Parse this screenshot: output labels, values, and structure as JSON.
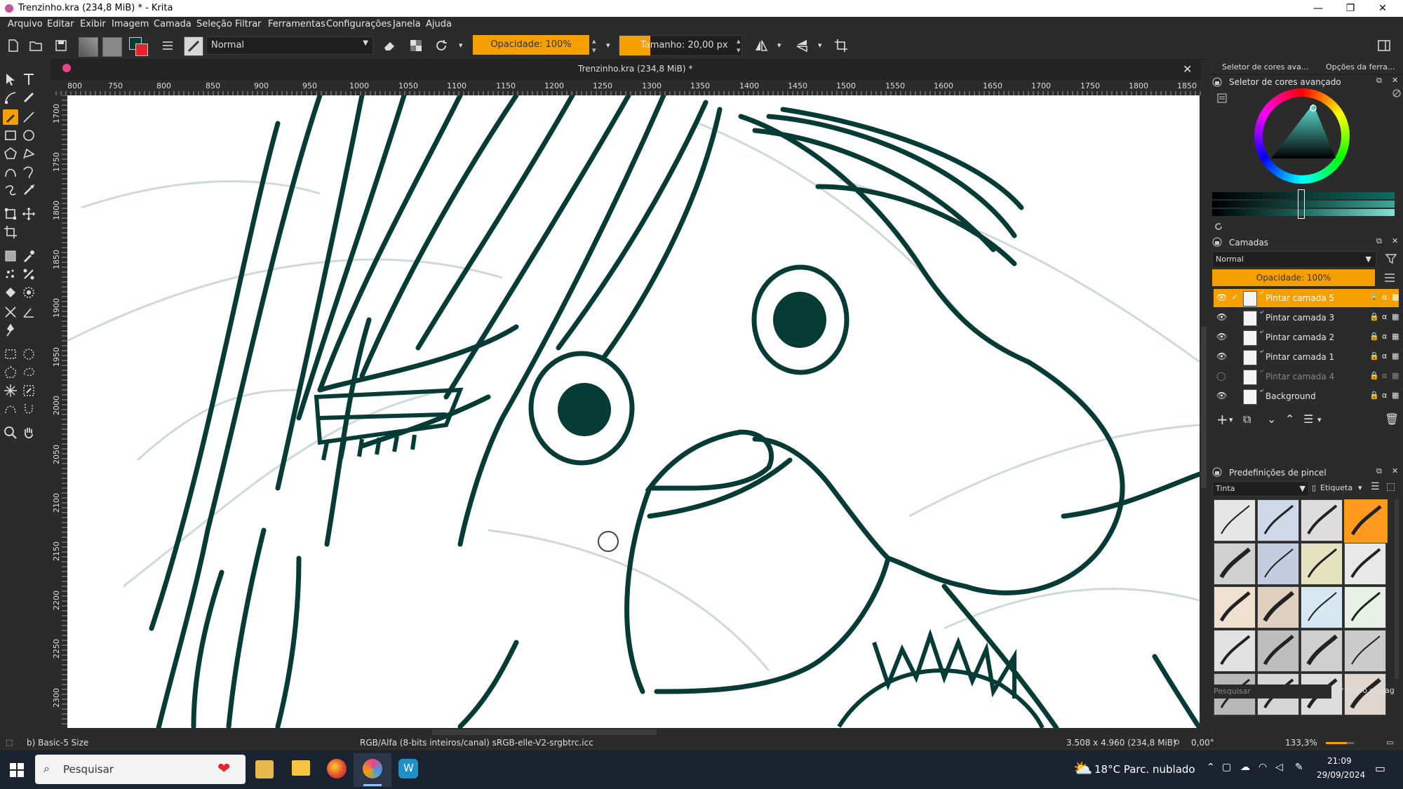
{
  "window": {
    "title": "Trenzinho.kra (234,8 MiB) * - Krita",
    "minimize": "—",
    "maximize": "❐",
    "close": "✕"
  },
  "menu": [
    "Arquivo",
    "Editar",
    "Exibir",
    "Imagem",
    "Camada",
    "Seleção",
    "Filtrar",
    "Ferramentas",
    "Configurações",
    "Janela",
    "Ajuda"
  ],
  "toolbar": {
    "blend_mode": "Normal",
    "opacity": "Opacidade: 100%",
    "size": "Tamanho: 20,00 px"
  },
  "document": {
    "tab_title": "Trenzinho.kra (234,8 MiB) *",
    "close": "✕"
  },
  "ruler_top": [
    "800",
    "750",
    "800",
    "850",
    "900",
    "950",
    "1000",
    "1050",
    "1100",
    "1150",
    "1200",
    "1250",
    "1300",
    "1350",
    "1400",
    "1450",
    "1500",
    "1550",
    "1600",
    "1650",
    "1700",
    "1750",
    "1800",
    "1850"
  ],
  "ruler_left": [
    "1700",
    "1750",
    "1800",
    "1850",
    "1900",
    "1950",
    "2000",
    "2050",
    "2100",
    "2150",
    "2200",
    "2250",
    "2300"
  ],
  "docker": {
    "tab_color": "Seletor de cores ava...",
    "tab_tool": "Opções da ferra...",
    "color_title": "Seletor de cores avançado",
    "layers_title": "Camadas",
    "layers_blend": "Normal",
    "layers_opacity": "Opacidade:  100%",
    "layers": [
      {
        "name": "Pintar camada 5",
        "active": true
      },
      {
        "name": "Pintar camada 3",
        "active": false
      },
      {
        "name": "Pintar camada 2",
        "active": false
      },
      {
        "name": "Pintar camada 1",
        "active": false
      },
      {
        "name": "Pintar camada 4",
        "active": false
      },
      {
        "name": "Background",
        "active": false
      }
    ],
    "brush_title": "Predefinições de pincel",
    "brush_tag": "Tinta",
    "brush_label": "Etiqueta",
    "search_placeholder": "Pesquisar",
    "filter_label": "Filtro na tag"
  },
  "status": {
    "brush": "b) Basic-5 Size",
    "color_profile": "RGB/Alfa (8-bits inteiros/canal)  sRGB-elle-V2-srgbtrc.icc",
    "dimensions": "3.508 x 4.960 (234,8 MiB)",
    "rotation": "0,00°",
    "zoom": "133,3%"
  },
  "taskbar": {
    "search": "Pesquisar",
    "weather": "18°C  Parc. nublado",
    "time": "21:09",
    "date": "29/09/2024"
  },
  "colors": {
    "accent": "#f6a000",
    "ink": "#063b36",
    "sketch": "#c9d6d3"
  }
}
